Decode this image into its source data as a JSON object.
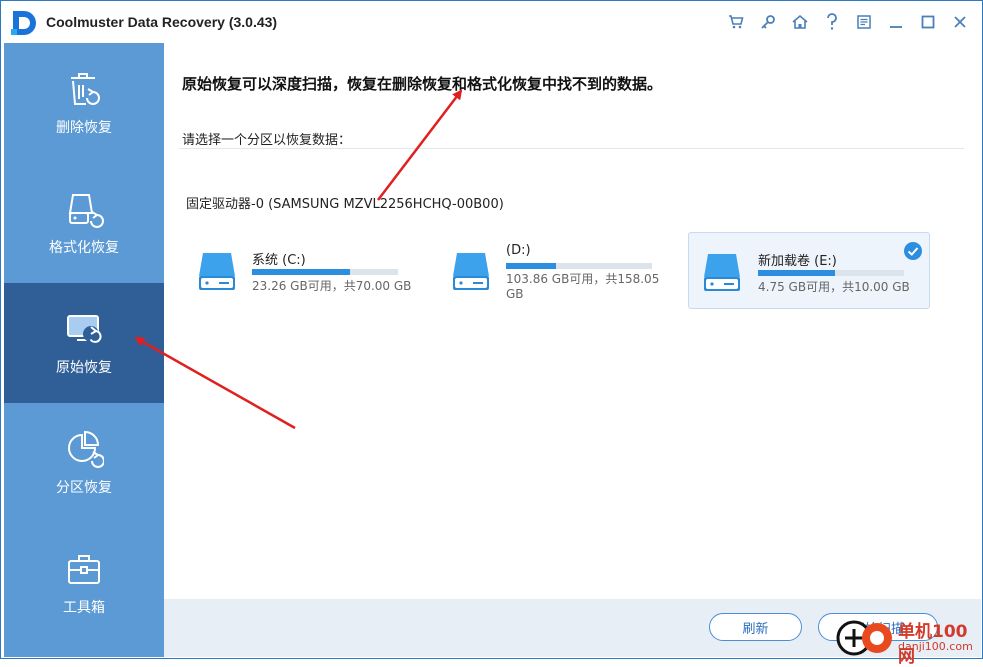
{
  "window": {
    "title": "Coolmuster Data Recovery (3.0.43)"
  },
  "titlebar_icons": [
    "cart-icon",
    "key-icon",
    "home-icon",
    "help-icon",
    "register-icon",
    "minimize-icon",
    "maximize-icon",
    "close-icon"
  ],
  "sidebar": {
    "items": [
      {
        "label": "删除恢复",
        "icon": "trash-restore-icon",
        "active": false
      },
      {
        "label": "格式化恢复",
        "icon": "disk-restore-icon",
        "active": false
      },
      {
        "label": "原始恢复",
        "icon": "monitor-restore-icon",
        "active": true
      },
      {
        "label": "分区恢复",
        "icon": "pie-restore-icon",
        "active": false
      },
      {
        "label": "工具箱",
        "icon": "toolbox-icon",
        "active": false
      }
    ]
  },
  "main": {
    "headline": "原始恢复可以深度扫描，恢复在删除恢复和格式化恢复中找不到的数据。",
    "prompt": "请选择一个分区以恢复数据：",
    "drive_title": "固定驱动器-0 (SAMSUNG  MZVL2256HCHQ-00B00)",
    "partitions": [
      {
        "name": "系统 (C:)",
        "info": "23.26 GB可用，共70.00 GB",
        "used_fraction": 0.67,
        "selected": false
      },
      {
        "name": "(D:)",
        "info": "103.86 GB可用，共158.05 GB",
        "used_fraction": 0.34,
        "selected": false
      },
      {
        "name": "新加载卷 (E:)",
        "info": "4.75 GB可用，共10.00 GB",
        "used_fraction": 0.525,
        "selected": true
      }
    ]
  },
  "buttons": {
    "refresh": "刷新",
    "scan": "开始扫描"
  },
  "watermark": {
    "name": "单机100网",
    "url": "danji100.com"
  },
  "colors": {
    "sidebar": "#5b9ad4",
    "sidebar_active": "#2f5f96",
    "accent": "#2d8ee0",
    "annotation_arrow": "#e02020"
  }
}
